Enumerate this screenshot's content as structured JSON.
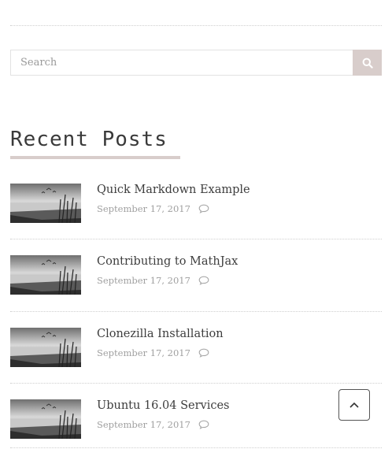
{
  "search": {
    "placeholder": "Search",
    "button_icon": "search-icon",
    "button_color": "#d8cdcb"
  },
  "recent_posts": {
    "heading": "Recent Posts",
    "items": [
      {
        "title": "Quick Markdown Example",
        "date": "September 17, 2017",
        "comment_icon": "comment-icon"
      },
      {
        "title": "Contributing to MathJax",
        "date": "September 17, 2017",
        "comment_icon": "comment-icon"
      },
      {
        "title": "Clonezilla Installation",
        "date": "September 17, 2017",
        "comment_icon": "comment-icon"
      },
      {
        "title": "Ubuntu 16.04 Services",
        "date": "September 17, 2017",
        "comment_icon": "comment-icon"
      }
    ]
  },
  "back_to_top": {
    "icon": "chevron-up-icon"
  },
  "colors": {
    "accent": "#d8cdcb",
    "divider": "#cfcfcf",
    "text": "#3d3d3d",
    "meta": "#a0a0a0"
  }
}
